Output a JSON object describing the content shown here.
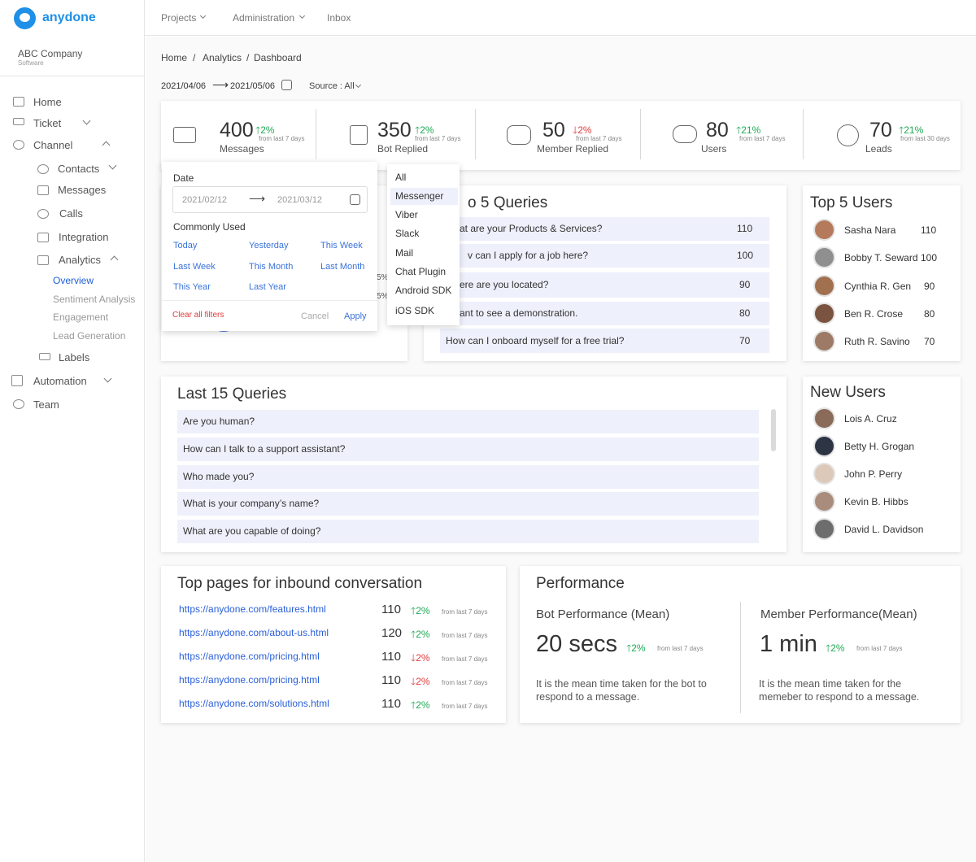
{
  "app": {
    "name": "anydone",
    "company": "ABC Company",
    "company_sub": "Software"
  },
  "topnav": {
    "projects": "Projects",
    "administration": "Administration",
    "inbox": "Inbox"
  },
  "sidebar": {
    "home": "Home",
    "ticket": "Ticket",
    "channel": "Channel",
    "contacts": "Contacts",
    "messages": "Messages",
    "calls": "Calls",
    "integration": "Integration",
    "analytics": "Analytics",
    "overview": "Overview",
    "sentiment": "Sentiment Analysis",
    "engagement": "Engagement",
    "lead_generation": "Lead Generation",
    "labels": "Labels",
    "automation": "Automation",
    "team": "Team"
  },
  "breadcrumb": {
    "home": "Home",
    "sep": "/",
    "analytics": "Analytics",
    "dashboard": "Dashboard"
  },
  "filters": {
    "date_from": "2021/04/06",
    "date_to": "2021/05/06",
    "arrow": "⟶",
    "source": "Source : All"
  },
  "stats": [
    {
      "value": "400",
      "pct": "2%",
      "dir": "up",
      "from": "from last 7 days",
      "label": "Messages"
    },
    {
      "value": "350",
      "pct": "2%",
      "dir": "up",
      "from": "from last 7 days",
      "label": "Bot Replied"
    },
    {
      "value": "50",
      "pct": "2%",
      "dir": "down",
      "from": "from last 7 days",
      "label": "Member Replied"
    },
    {
      "value": "80",
      "pct": "21%",
      "dir": "up",
      "from": "from last 7 days",
      "label": "Users"
    },
    {
      "value": "70",
      "pct": "21%",
      "dir": "up",
      "from": "from last 30 days",
      "label": "Leads"
    }
  ],
  "arrows": {
    "up": "🡑",
    "down": "🡓"
  },
  "date_popup": {
    "title": "Date",
    "from_placeholder": "2021/02/12",
    "to_placeholder": "2021/03/12",
    "arrow": "⟶",
    "commonly_used": "Commonly Used",
    "options": [
      "Today",
      "Yesterday",
      "This Week",
      "Last Week",
      "This Month",
      "Last Month",
      "This Year",
      "Last Year"
    ],
    "clear": "Clear all filters",
    "cancel": "Cancel",
    "apply": "Apply"
  },
  "source_menu": {
    "items": [
      "All",
      "Messenger",
      "Viber",
      "Slack",
      "Mail",
      "Chat Plugin",
      "Android SDK",
      "iOS SDK"
    ],
    "selected": "Messenger"
  },
  "hidden_pct": {
    "a": "5%",
    "b": "5%"
  },
  "top_queries": {
    "title": "o 5 Queries",
    "rows": [
      {
        "text": "at are your Products & Services?",
        "value": "110"
      },
      {
        "text": "v can I apply for a job here?",
        "value": "100"
      },
      {
        "text": "ere are you located?",
        "value": "90"
      },
      {
        "text": "ant to see a demonstration.",
        "value": "80"
      },
      {
        "text": "How can I onboard myself for a free trial?",
        "value": "70"
      }
    ]
  },
  "top_users": {
    "title": "Top 5 Users",
    "rows": [
      {
        "name": "Sasha Nara",
        "value": "110"
      },
      {
        "name": "Bobby T. Seward",
        "value": "100"
      },
      {
        "name": "Cynthia R. Gen",
        "value": "90"
      },
      {
        "name": "Ben R. Crose",
        "value": "80"
      },
      {
        "name": "Ruth R. Savino",
        "value": "70"
      }
    ]
  },
  "last_queries": {
    "title": "Last 15 Queries",
    "rows": [
      "Are you human?",
      "How can I talk to a support assistant?",
      "Who made you?",
      "What is your company’s name?",
      "What are you capable of doing?"
    ]
  },
  "new_users": {
    "title": "New Users",
    "rows": [
      "Lois A. Cruz",
      "Betty H. Grogan",
      "John P. Perry",
      "Kevin B. Hibbs",
      "David L. Davidson"
    ]
  },
  "top_pages": {
    "title": "Top pages for inbound conversation",
    "rows": [
      {
        "url": "https://anydone.com/features.html",
        "value": "110",
        "pct": "2%",
        "dir": "up",
        "from": "from last 7 days"
      },
      {
        "url": "https://anydone.com/about-us.html",
        "value": "120",
        "pct": "2%",
        "dir": "up",
        "from": "from last 7 days"
      },
      {
        "url": "https://anydone.com/pricing.html",
        "value": "110",
        "pct": "2%",
        "dir": "down",
        "from": "from last 7 days"
      },
      {
        "url": "https://anydone.com/pricing.html",
        "value": "110",
        "pct": "2%",
        "dir": "down",
        "from": "from last 7 days"
      },
      {
        "url": "https://anydone.com/solutions.html",
        "value": "110",
        "pct": "2%",
        "dir": "up",
        "from": "from last 7 days"
      }
    ]
  },
  "performance": {
    "title": "Performance",
    "bot": {
      "title": "Bot Performance (Mean)",
      "value": "20 secs",
      "pct": "2%",
      "from": "from last 7 days",
      "desc": "It is the mean time taken for the bot to respond to a message."
    },
    "member": {
      "title": "Member Performance(Mean)",
      "value": "1 min",
      "pct": "2%",
      "from": "from last 7 days",
      "desc": "It is the mean time taken for the memeber to respond to a message."
    }
  },
  "colors": {
    "brand": "#1e90e8",
    "up": "#1faa55",
    "down": "#e23b3b",
    "link": "#2a5fd8",
    "row_bg": "#eef0fb",
    "active_nav": "#1e5fd8"
  }
}
